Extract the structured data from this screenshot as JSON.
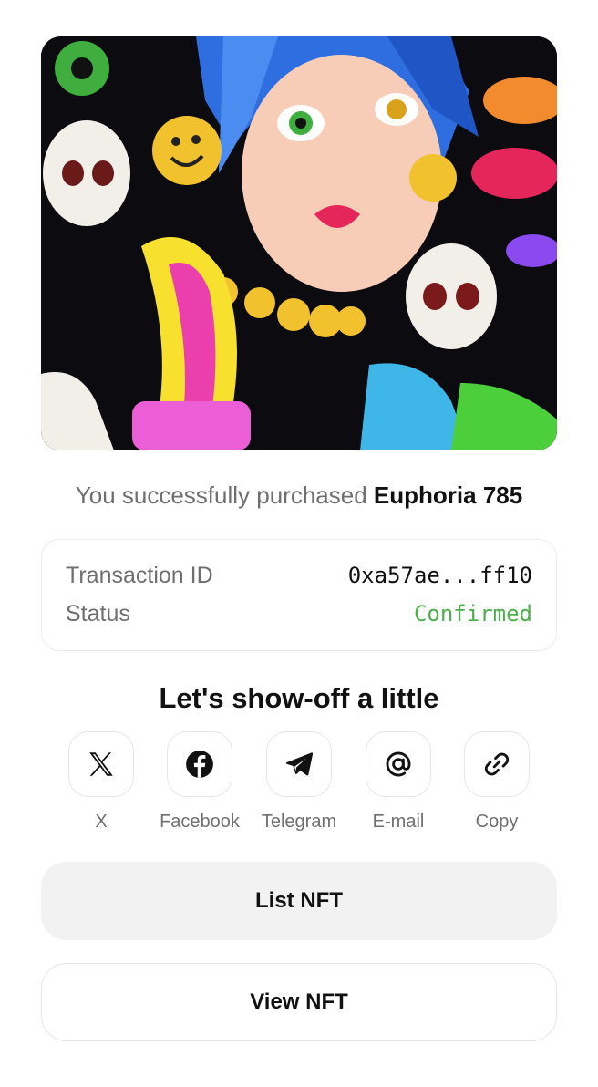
{
  "artwork": {
    "alt": "Euphoria 785"
  },
  "purchase": {
    "prefix": "You successfully purchased",
    "item_name": "Euphoria 785"
  },
  "transaction": {
    "id_label": "Transaction ID",
    "id_value": "0xa57ae...ff10",
    "status_label": "Status",
    "status_value": "Confirmed",
    "status_color": "#4cae4c"
  },
  "share": {
    "title": "Let's show-off a little",
    "items": [
      {
        "label": "X",
        "icon": "x-logo-icon"
      },
      {
        "label": "Facebook",
        "icon": "facebook-icon"
      },
      {
        "label": "Telegram",
        "icon": "telegram-icon"
      },
      {
        "label": "E-mail",
        "icon": "at-sign-icon"
      },
      {
        "label": "Copy",
        "icon": "link-icon"
      }
    ]
  },
  "actions": {
    "list_label": "List NFT",
    "view_label": "View NFT"
  }
}
